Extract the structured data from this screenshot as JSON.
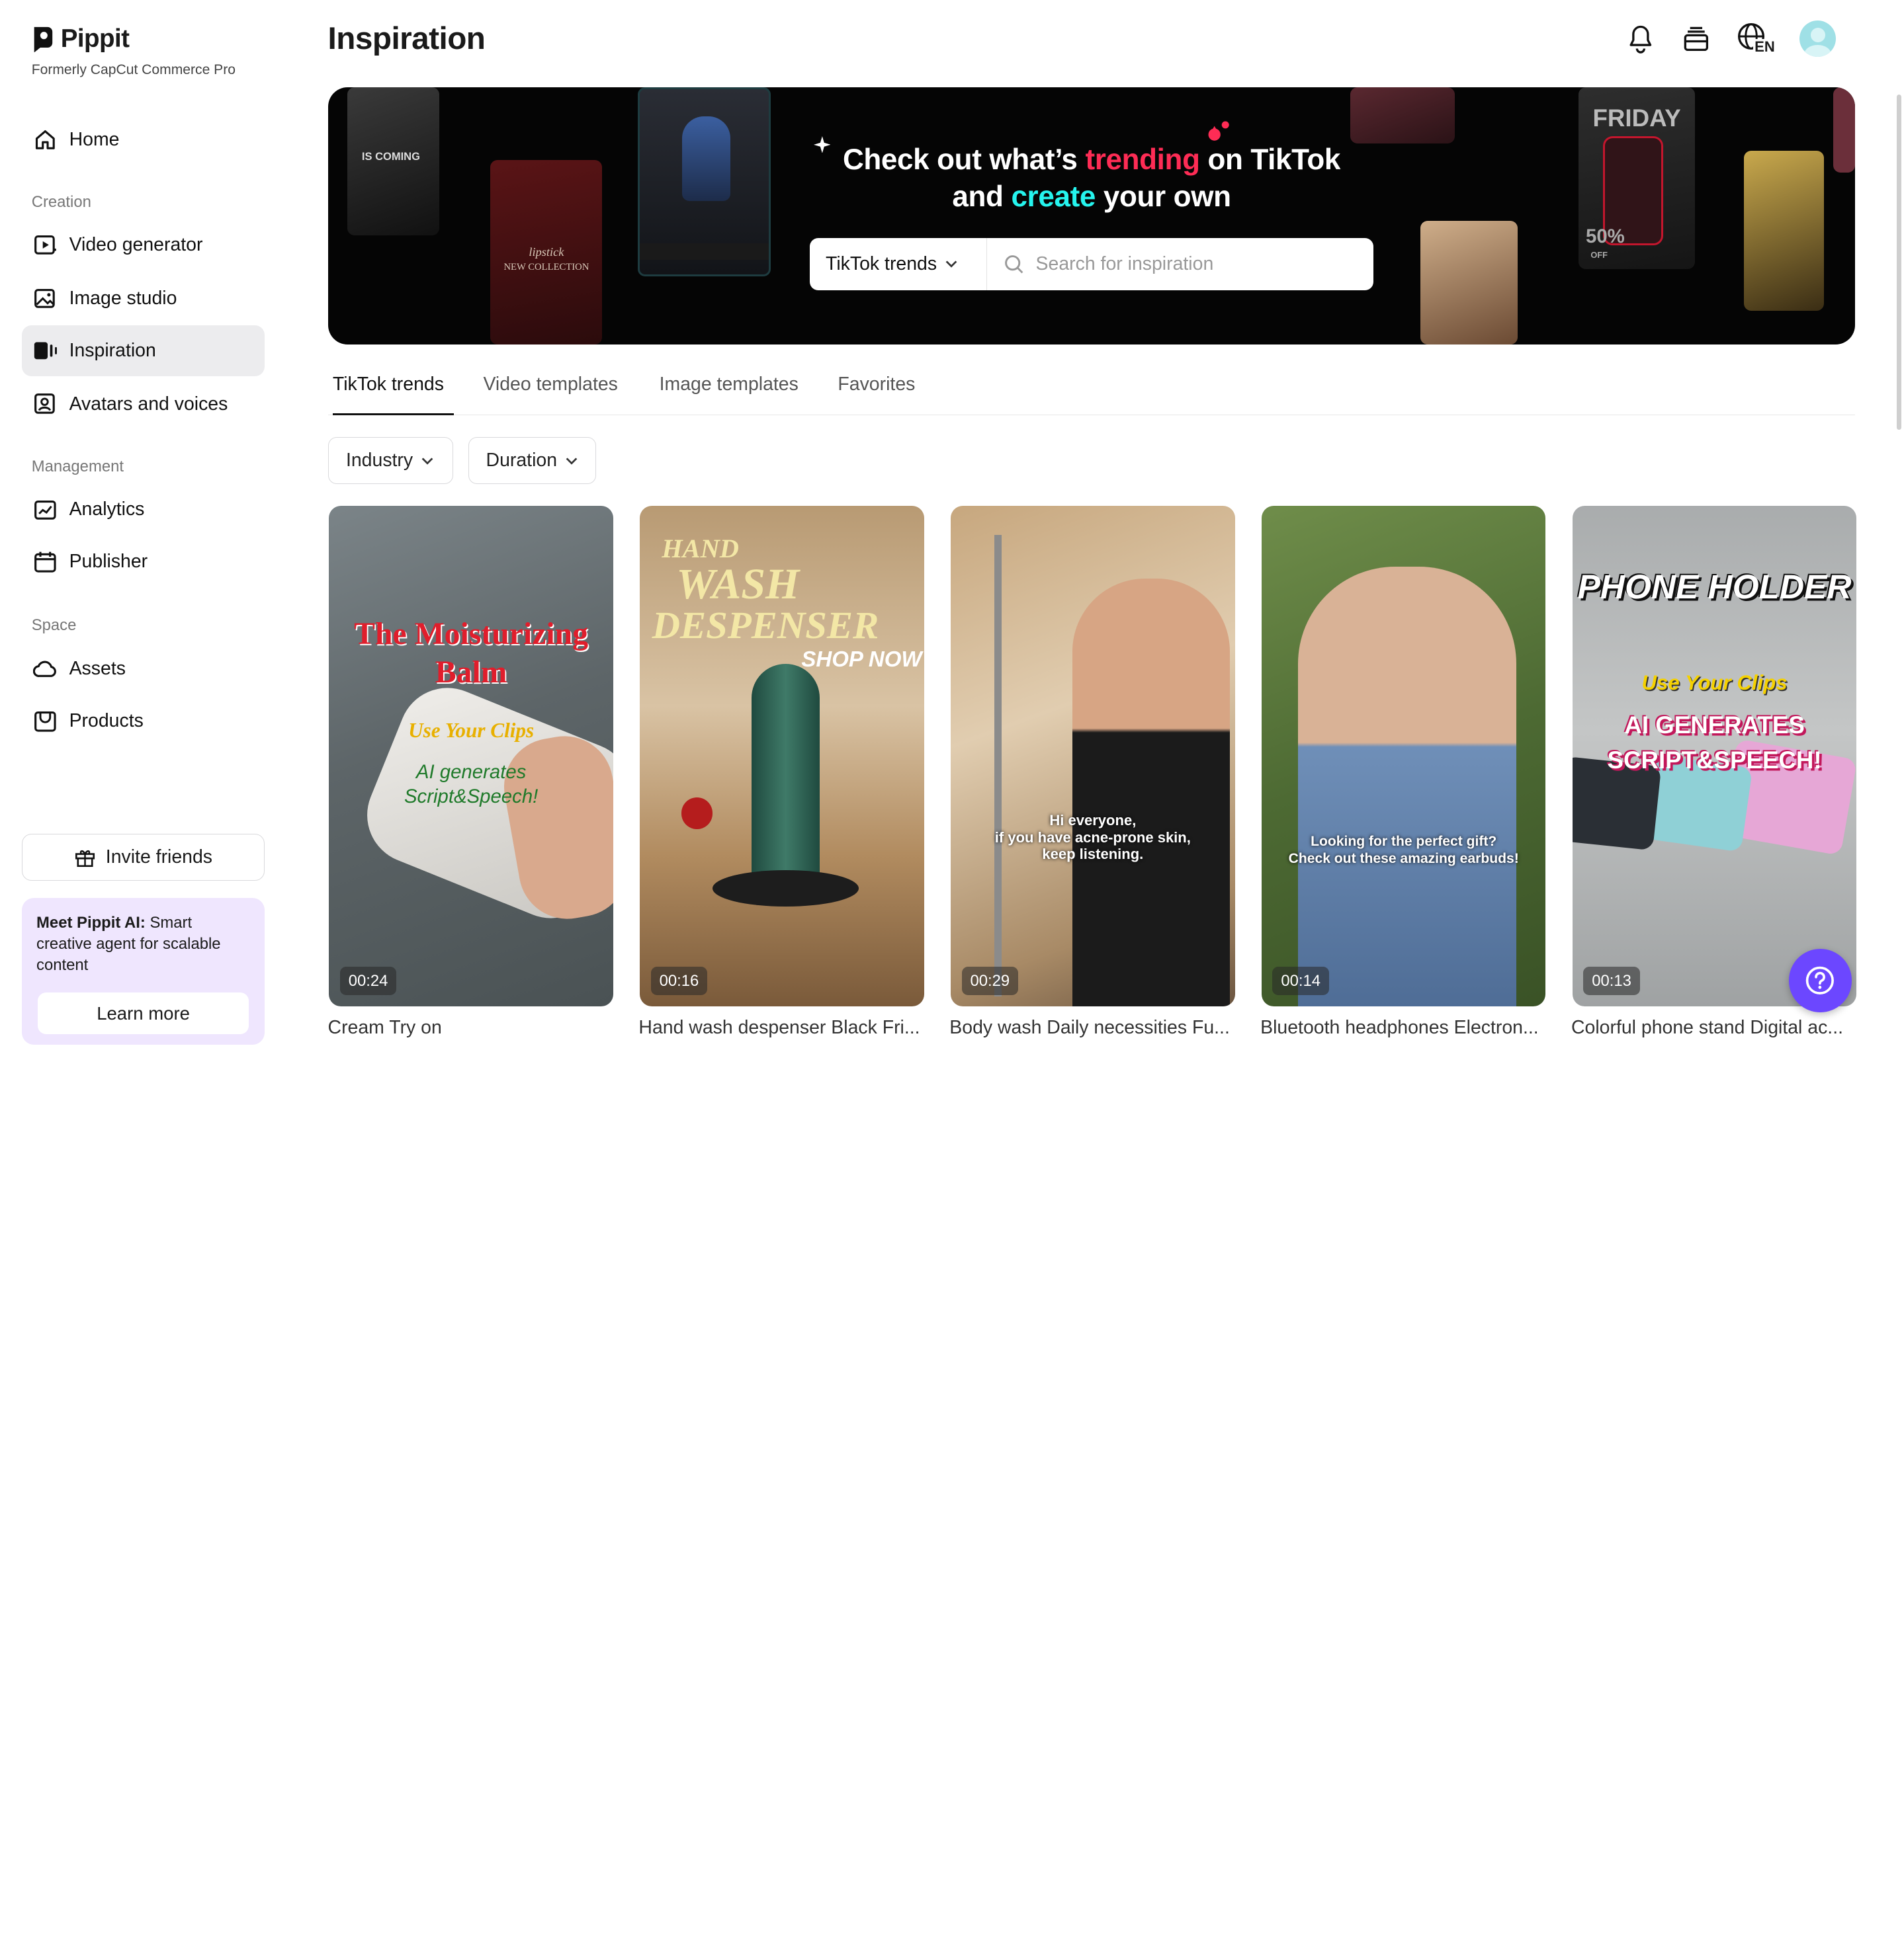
{
  "brand": {
    "name": "Pippit",
    "subtitle": "Formerly CapCut Commerce Pro"
  },
  "nav": {
    "home": "Home",
    "section_creation": "Creation",
    "video_generator": "Video generator",
    "image_studio": "Image studio",
    "inspiration": "Inspiration",
    "avatars_voices": "Avatars and voices",
    "section_management": "Management",
    "analytics": "Analytics",
    "publisher": "Publisher",
    "section_space": "Space",
    "assets": "Assets",
    "products": "Products"
  },
  "invite": {
    "label": "Invite friends"
  },
  "promo": {
    "bold": "Meet Pippit AI:",
    "text": " Smart creative agent for scalable content",
    "button": "Learn more"
  },
  "page": {
    "title": "Inspiration",
    "lang_badge": "EN"
  },
  "banner": {
    "line1_a": "Check out what’s ",
    "line1_hl": "trending",
    "line1_b": " on TikTok",
    "line2_a": "and ",
    "line2_hl": "create",
    "line2_b": " your own",
    "select_value": "TikTok trends",
    "search_placeholder": "Search for inspiration",
    "thumb_texts": {
      "coming": "IS COMING",
      "lipstick1": "lipstick",
      "lipstick2": "NEW COLLECTION",
      "friday": "FRIDAY",
      "sale": "50%",
      "off": "OFF"
    }
  },
  "tabs": [
    "TikTok trends",
    "Video templates",
    "Image templates",
    "Favorites"
  ],
  "filters": {
    "industry": "Industry",
    "duration": "Duration"
  },
  "cards": [
    {
      "title": "Cream Try on",
      "duration": "00:24",
      "overlay": [
        "The Moisturizing",
        "Balm",
        "Use Your Clips",
        "AI generates",
        "Script&Speech!"
      ]
    },
    {
      "title": "Hand wash despenser Black Fri...",
      "duration": "00:16",
      "overlay": [
        "HAND",
        "WASH",
        "DESPENSER",
        "SHOP NOW"
      ]
    },
    {
      "title": "Body wash Daily necessities Fu...",
      "duration": "00:29",
      "overlay": [
        "Hi everyone,",
        "if you have acne-prone skin,",
        "keep listening."
      ]
    },
    {
      "title": "Bluetooth headphones Electron...",
      "duration": "00:14",
      "overlay": [
        "Looking for the perfect gift?",
        "Check out these amazing earbuds!"
      ]
    },
    {
      "title": "Colorful phone stand Digital ac...",
      "duration": "00:13",
      "overlay": [
        "PHONE HOLDER",
        "Use Your Clips",
        "AI GENERATES",
        "SCRIPT&SPEECH!"
      ]
    }
  ],
  "colors": {
    "trending": "#fe2c55",
    "create": "#25f4ee",
    "active_nav_bg": "#ececee",
    "promo_bg": "#efe6fe",
    "help_button": "#6c47ff"
  }
}
